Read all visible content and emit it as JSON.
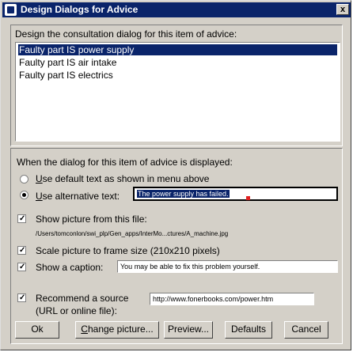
{
  "window": {
    "title": "Design Dialogs for Advice",
    "close_glyph": "x"
  },
  "top": {
    "label": "Design the consultation dialog for this item of advice:",
    "items": [
      "Faulty part IS power supply",
      "Faulty part IS air intake",
      "Faulty part IS electrics"
    ],
    "selected_index": 0
  },
  "bottom": {
    "label": "When the dialog for this item of advice is displayed:",
    "radio_default": {
      "u": "U",
      "rest": "se default text as shown in menu above",
      "selected": false
    },
    "radio_alt": {
      "u": "U",
      "rest": "se alternative text:",
      "selected": true,
      "value": "The power supply has failed."
    },
    "show_picture": {
      "label": "Show picture from this file:",
      "checked": true,
      "path": "/Users/tomconlon/swi_plp/Gen_apps/InterMo...ctures/A_machine.jpg"
    },
    "scale_picture": {
      "label": "Scale picture to frame size (210x210 pixels)",
      "checked": true
    },
    "caption": {
      "label": "Show a caption:",
      "checked": true,
      "value": "You may be able to fix this problem yourself."
    },
    "recommend": {
      "label1": "Recommend a source",
      "label2": "(URL or online file):",
      "checked": true,
      "value": "http://www.fonerbooks.com/power.htm"
    }
  },
  "buttons": {
    "ok": "Ok",
    "change_picture": {
      "u": "C",
      "rest": "hange picture..."
    },
    "preview": "Preview...",
    "defaults": "Defaults",
    "cancel": "Cancel"
  },
  "colors": {
    "selection": "#0a246a",
    "face": "#d4d0c8"
  }
}
